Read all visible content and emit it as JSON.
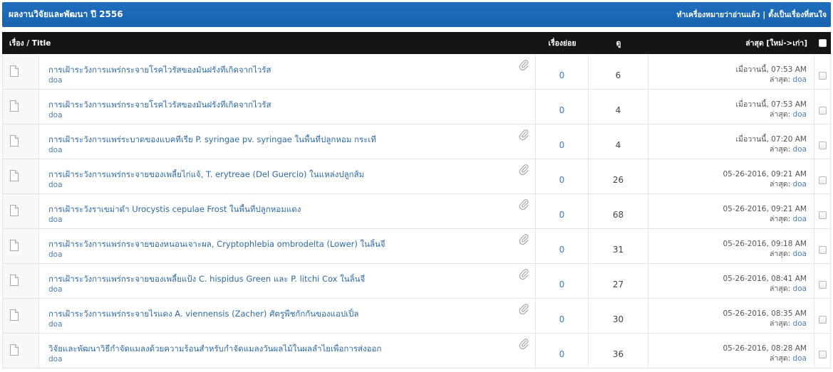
{
  "header": {
    "title": "ผลงานวิจัยและพัฒนา ปี 2556",
    "mark_read_label": "ทำเครื่องหมายว่าอ่านแล้ว",
    "separator": "|",
    "subscribe_label": "ตั้งเป็นเรื่องที่สนใจ"
  },
  "columns": {
    "title": "เรื่อง / Title",
    "replies": "เรื่องย่อย",
    "views": "ดู",
    "last_post": "ล่าสุด [ใหม่->เก่า]"
  },
  "labels": {
    "last_post_by": "ล่าสุด:"
  },
  "icons": {
    "thread": "file-icon",
    "attachment": "paperclip-icon",
    "select": "checkbox"
  },
  "colors": {
    "header_bar": "#1f6fbf",
    "column_header": "#151515",
    "link": "#2e6aa8",
    "text": "#555555"
  },
  "threads": [
    {
      "title": "การเฝ้าระวังการแพร่กระจายโรคไวรัสของมันฝรั่งที่เกิดจากไวรัส",
      "author": "doa",
      "has_attachment": true,
      "replies": "0",
      "views": "6",
      "last_post_date": "เมื่อวานนี้, 07:53 AM",
      "last_poster": "doa"
    },
    {
      "title": "การเฝ้าระวังการแพร่กระจายโรคไวรัสของมันฝรั่งที่เกิดจากไวรัส",
      "author": "doa",
      "has_attachment": false,
      "replies": "0",
      "views": "4",
      "last_post_date": "เมื่อวานนี้, 07:53 AM",
      "last_poster": "doa"
    },
    {
      "title": "การเฝ้าระวังการแพร่ระบาดของแบคทีเรีย P. syringae pv. syringae ในพื้นที่ปลูกหอม กระเที",
      "author": "doa",
      "has_attachment": true,
      "replies": "0",
      "views": "4",
      "last_post_date": "เมื่อวานนี้, 07:20 AM",
      "last_poster": "doa"
    },
    {
      "title": "การเฝ้าระวังการแพร่กระจายของเพลี้ยไก่แจ้, T. erytreae (Del Guercio) ในแหล่งปลูกส้ม",
      "author": "doa",
      "has_attachment": true,
      "replies": "0",
      "views": "26",
      "last_post_date": "05-26-2016, 09:21 AM",
      "last_poster": "doa"
    },
    {
      "title": "การเฝ้าระวังราเขม่าดำ Urocystis cepulae Frost ในพื้นที่ปลูกหอมแดง",
      "author": "doa",
      "has_attachment": true,
      "replies": "0",
      "views": "68",
      "last_post_date": "05-26-2016, 09:21 AM",
      "last_poster": "doa"
    },
    {
      "title": "การเฝ้าระวังการแพร่กระจายของหนอนเจาะผล, Cryptophlebia ombrodelta (Lower) ในลิ้นจี่",
      "author": "doa",
      "has_attachment": true,
      "replies": "0",
      "views": "31",
      "last_post_date": "05-26-2016, 09:18 AM",
      "last_poster": "doa"
    },
    {
      "title": "การเฝ้าระวังการแพร่กระจายของเพลี้ยแป้ง C. hispidus Green และ P. litchi Cox ในลิ้นจี่",
      "author": "doa",
      "has_attachment": true,
      "replies": "0",
      "views": "27",
      "last_post_date": "05-26-2016, 08:41 AM",
      "last_poster": "doa"
    },
    {
      "title": "การเฝ้าระวังการแพร่กระจายไรแดง A. viennensis (Zacher) ศัตรูพืชกักกันของแอปเปิ้ล",
      "author": "doa",
      "has_attachment": true,
      "replies": "0",
      "views": "30",
      "last_post_date": "05-26-2016, 08:35 AM",
      "last_poster": "doa"
    },
    {
      "title": "วิจัยและพัฒนาวิธีกำจัดแมลงด้วยความร้อนสำหรับกำจัดแมลงวันผลไม้ในผลลำไยเพื่อการส่งออก",
      "author": "doa",
      "has_attachment": true,
      "replies": "0",
      "views": "36",
      "last_post_date": "05-26-2016, 08:28 AM",
      "last_poster": "doa"
    }
  ]
}
